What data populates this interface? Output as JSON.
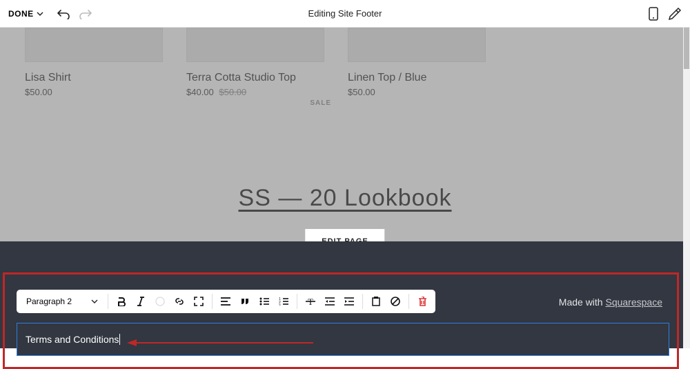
{
  "topbar": {
    "done_label": "DONE",
    "title": "Editing Site Footer"
  },
  "products": [
    {
      "name": "Lisa Shirt",
      "price": "$50.00",
      "sale_price": "",
      "sale": false
    },
    {
      "name": "Terra Cotta Studio Top",
      "price": "$50.00",
      "sale_price": "$40.00",
      "sale": true,
      "sale_badge": "SALE"
    },
    {
      "name": "Linen Top / Blue",
      "price": "$50.00",
      "sale_price": "",
      "sale": false
    }
  ],
  "lookbook": {
    "title": "SS — 20 Lookbook",
    "edit_btn": "EDIT PAGE"
  },
  "toolbar": {
    "format_label": "Paragraph 2"
  },
  "footer": {
    "credit_prefix": "Made with ",
    "credit_link": "Squarespace",
    "text_input_value": "Terms and Conditions"
  }
}
